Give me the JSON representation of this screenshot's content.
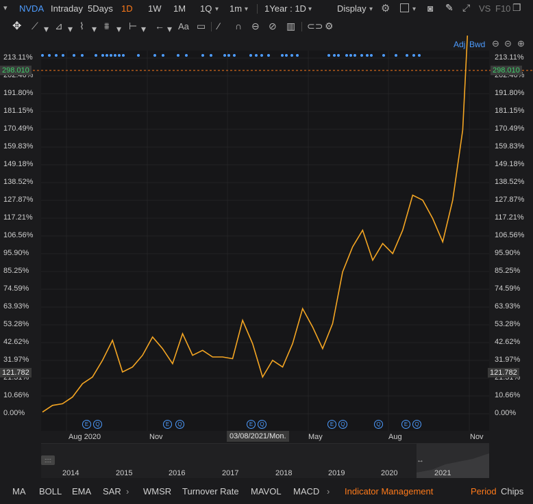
{
  "toolbar": {
    "symbol": "NVDA",
    "intraday": "Intraday",
    "five_days": "5Days",
    "d1": "1D",
    "w1": "1W",
    "m1": "1M",
    "q1": "1Q",
    "min1": "1m",
    "range": "1Year : 1D",
    "display": "Display",
    "vs": "VS",
    "f10": "F10"
  },
  "tools": {
    "font_tool": "Aa",
    "adj": "Adj",
    "bwd": "Bwd"
  },
  "chart": {
    "line_color": "#f5a623",
    "accent_color": "#ff7a1a",
    "marker_color": "#4d9cff",
    "current_price": "298.010",
    "cursor_price": "121.782",
    "cursor_date": "03/08/2021/Mon.",
    "y_ticks": [
      "213.11%",
      "202.46%",
      "191.80%",
      "181.15%",
      "170.49%",
      "159.83%",
      "149.18%",
      "138.52%",
      "127.87%",
      "117.21%",
      "106.56%",
      "95.90%",
      "85.25%",
      "74.59%",
      "63.93%",
      "53.28%",
      "42.62%",
      "31.97%",
      "21.31%",
      "10.66%",
      "0.00%"
    ],
    "x_ticks": [
      "Aug 2020",
      "Nov",
      "May",
      "Aug",
      "Nov"
    ],
    "event_markers": [
      "E",
      "Q",
      "E",
      "Q",
      "E",
      "Q",
      "E",
      "Q",
      "Q",
      "E",
      "Q"
    ],
    "overview_years": [
      "2014",
      "2015",
      "2016",
      "2017",
      "2018",
      "2019",
      "2020",
      "2021"
    ]
  },
  "chart_data": {
    "type": "line",
    "title": "",
    "xlabel": "",
    "ylabel": "",
    "ylim": [
      0,
      213.11
    ],
    "x": [
      "2020-07",
      "2020-07",
      "2020-08",
      "2020-08",
      "2020-08",
      "2020-08",
      "2020-09",
      "2020-09",
      "2020-09",
      "2020-10",
      "2020-10",
      "2020-10",
      "2020-11",
      "2020-11",
      "2020-11",
      "2020-12",
      "2020-12",
      "2021-01",
      "2021-01",
      "2021-02",
      "2021-02",
      "2021-03",
      "2021-03",
      "2021-03",
      "2021-04",
      "2021-04",
      "2021-04",
      "2021-05",
      "2021-05",
      "2021-05",
      "2021-06",
      "2021-06",
      "2021-07",
      "2021-07",
      "2021-07",
      "2021-08",
      "2021-08",
      "2021-08",
      "2021-09",
      "2021-09",
      "2021-10",
      "2021-10",
      "2021-11",
      "2021-11"
    ],
    "series": [
      {
        "values": [
          1,
          5,
          6,
          10,
          18,
          22,
          32,
          44,
          25,
          28,
          35,
          46,
          39,
          30,
          48,
          35,
          38,
          34,
          34,
          33,
          56,
          42,
          22,
          32,
          28,
          42,
          63,
          52,
          39,
          54,
          85,
          100,
          110,
          92,
          102,
          96,
          110,
          131,
          128,
          117,
          103,
          128,
          170,
          290
        ]
      }
    ]
  },
  "bottom": {
    "items": [
      "MA",
      "BOLL",
      "EMA",
      "SAR",
      "WMSR",
      "Turnover Rate",
      "MAVOL",
      "MACD"
    ],
    "indicator_mgmt": "Indicator Management",
    "period": "Period",
    "chips": "Chips"
  }
}
